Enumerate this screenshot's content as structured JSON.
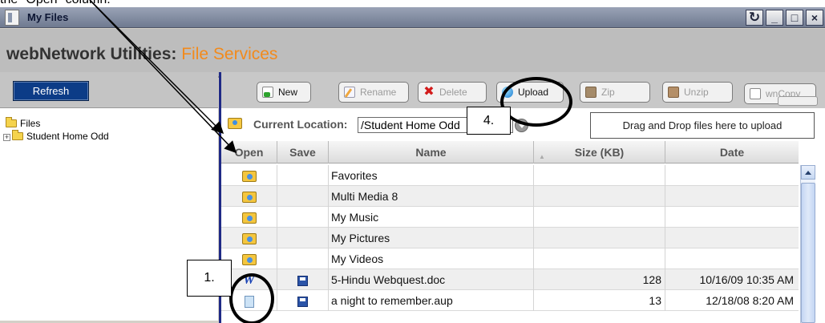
{
  "caption": "the \"Open\" column.",
  "window": {
    "title": "My Files",
    "refresh_glyph": "↻",
    "minimize_glyph": "_",
    "maximize_glyph": "□",
    "close_glyph": "×"
  },
  "header": {
    "title": "webNetwork Utilities:",
    "subtitle": "File Services"
  },
  "left": {
    "refresh_label": "Refresh",
    "tree": [
      {
        "label": "Files"
      },
      {
        "label": "Student Home Odd",
        "expander": "+"
      }
    ]
  },
  "toolbar": {
    "new": "New",
    "rename": "Rename",
    "delete": "Delete",
    "upload": "Upload",
    "zip": "Zip",
    "unzip": "Unzip",
    "wncopy": "wnCopy"
  },
  "location": {
    "label": "Current Location:",
    "value": "/Student Home Odd",
    "drop_hint": "Drag and Drop files here to upload"
  },
  "table": {
    "columns": [
      "Open",
      "Save",
      "Name",
      "Size (KB)",
      "Date"
    ],
    "rows": [
      {
        "open_icon": "folder-open-icon",
        "save_icon": "",
        "name": "Favorites",
        "size": "",
        "date": ""
      },
      {
        "open_icon": "folder-open-icon",
        "save_icon": "",
        "name": "Multi Media 8",
        "size": "",
        "date": ""
      },
      {
        "open_icon": "folder-open-icon",
        "save_icon": "",
        "name": "My Music",
        "size": "",
        "date": ""
      },
      {
        "open_icon": "folder-open-icon",
        "save_icon": "",
        "name": "My Pictures",
        "size": "",
        "date": ""
      },
      {
        "open_icon": "folder-open-icon",
        "save_icon": "",
        "name": "My Videos",
        "size": "",
        "date": ""
      },
      {
        "open_icon": "word-doc-icon",
        "save_icon": "save-disk-icon",
        "name": "5-Hindu Webquest.doc",
        "size": "128",
        "date": "10/16/09 10:35 AM"
      },
      {
        "open_icon": "audio-file-icon",
        "save_icon": "save-disk-icon",
        "name": "a night to remember.aup",
        "size": "13",
        "date": "12/18/08 8:20 AM"
      }
    ]
  },
  "annotations": {
    "step1": "1.",
    "step4": "4."
  }
}
